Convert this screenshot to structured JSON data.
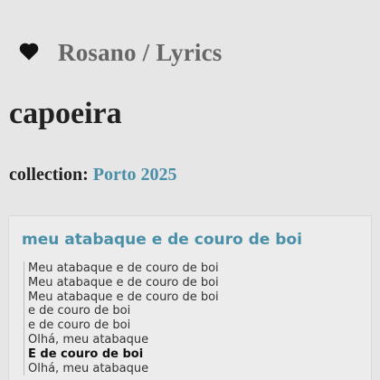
{
  "header": {
    "logo_icon": "heart-icon",
    "site_title": "Rosano / Lyrics"
  },
  "page": {
    "title": "capoeira"
  },
  "collection": {
    "label": "collection:",
    "link": "Porto 2025"
  },
  "song": {
    "title": "meu atabaque e de couro de boi",
    "lines": [
      {
        "text": "Meu atabaque e de couro de boi",
        "bold": false
      },
      {
        "text": "Meu atabaque e de couro de boi",
        "bold": false
      },
      {
        "text": "Meu atabaque e de couro de boi",
        "bold": false
      },
      {
        "text": "e de couro de boi",
        "bold": false
      },
      {
        "text": "e de couro de boi",
        "bold": false
      },
      {
        "text": "Olhá, meu atabaque",
        "bold": false
      },
      {
        "text": "E de couro de boi",
        "bold": true
      },
      {
        "text": "Olhá, meu atabaque",
        "bold": false
      }
    ]
  },
  "colors": {
    "background": "#e6e6e6",
    "link": "#4a8fa8",
    "site_title": "#666666"
  }
}
